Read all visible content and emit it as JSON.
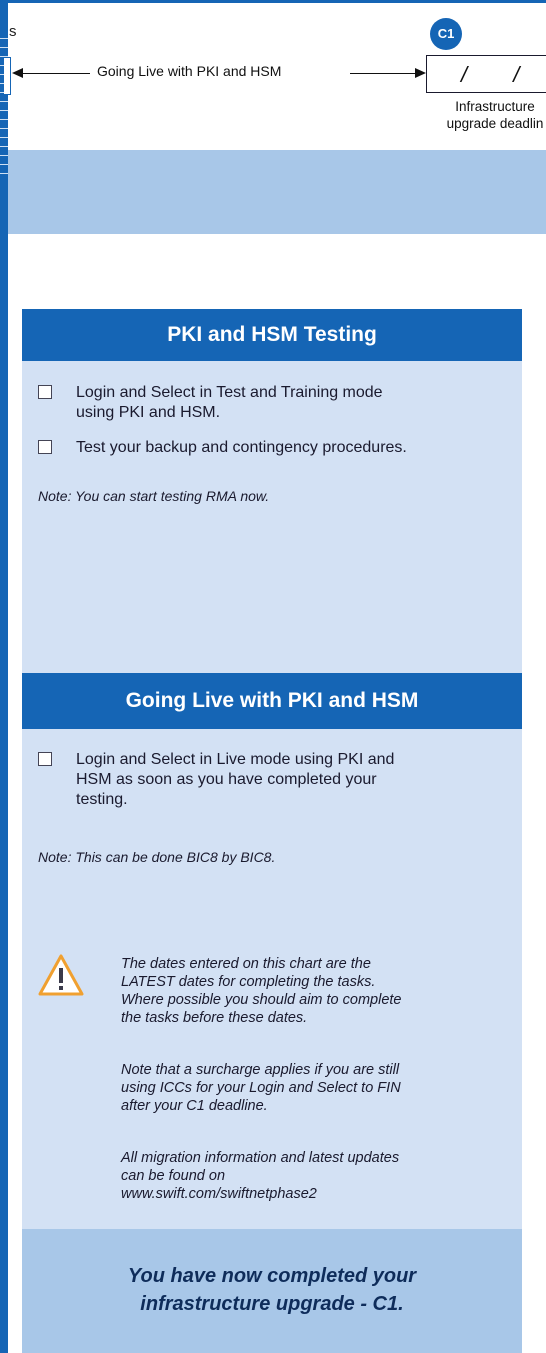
{
  "header": {
    "left_clip": "s",
    "timeline_label": "Going Live with PKI and HSM",
    "milestone_badge": "C1",
    "date_placeholder": "/ /",
    "deadline_caption_line1": "Infrastructure",
    "deadline_caption_line2": "upgrade deadlin"
  },
  "section_testing": {
    "title": "PKI and HSM Testing",
    "tasks": [
      {
        "line1": "Login and Select in Test and Training mode",
        "line2": "using PKI and HSM."
      },
      {
        "line1": "Test your backup and contingency procedures."
      }
    ],
    "note": "Note: You can start testing RMA now."
  },
  "section_live": {
    "title": "Going Live with PKI and HSM",
    "tasks": [
      {
        "line1": "Login and Select in Live mode using PKI and",
        "line2": "HSM as soon as you have completed your",
        "line3": "testing."
      }
    ],
    "note": "Note: This can be done BIC8 by BIC8."
  },
  "warning": {
    "icon": "warning-triangle-icon",
    "para1": [
      "The dates entered on this chart are the",
      "LATEST dates for completing the tasks.",
      "Where possible you should aim to complete",
      "the tasks before these dates."
    ],
    "para2": [
      "Note that a surcharge applies if you are still",
      "using ICCs for your Login and Select to FIN",
      "after your C1 deadline."
    ],
    "para3": [
      "All migration information and latest updates",
      "can be found on",
      "www.swift.com/swiftnetphase2"
    ]
  },
  "footer": {
    "line1": "You have now completed your",
    "line2": "infrastructure upgrade - C1."
  },
  "colors": {
    "brand_blue": "#1565b5",
    "light_band": "#a8c7e8",
    "column_bg": "#d3e1f4",
    "warning_orange": "#f0a030"
  }
}
